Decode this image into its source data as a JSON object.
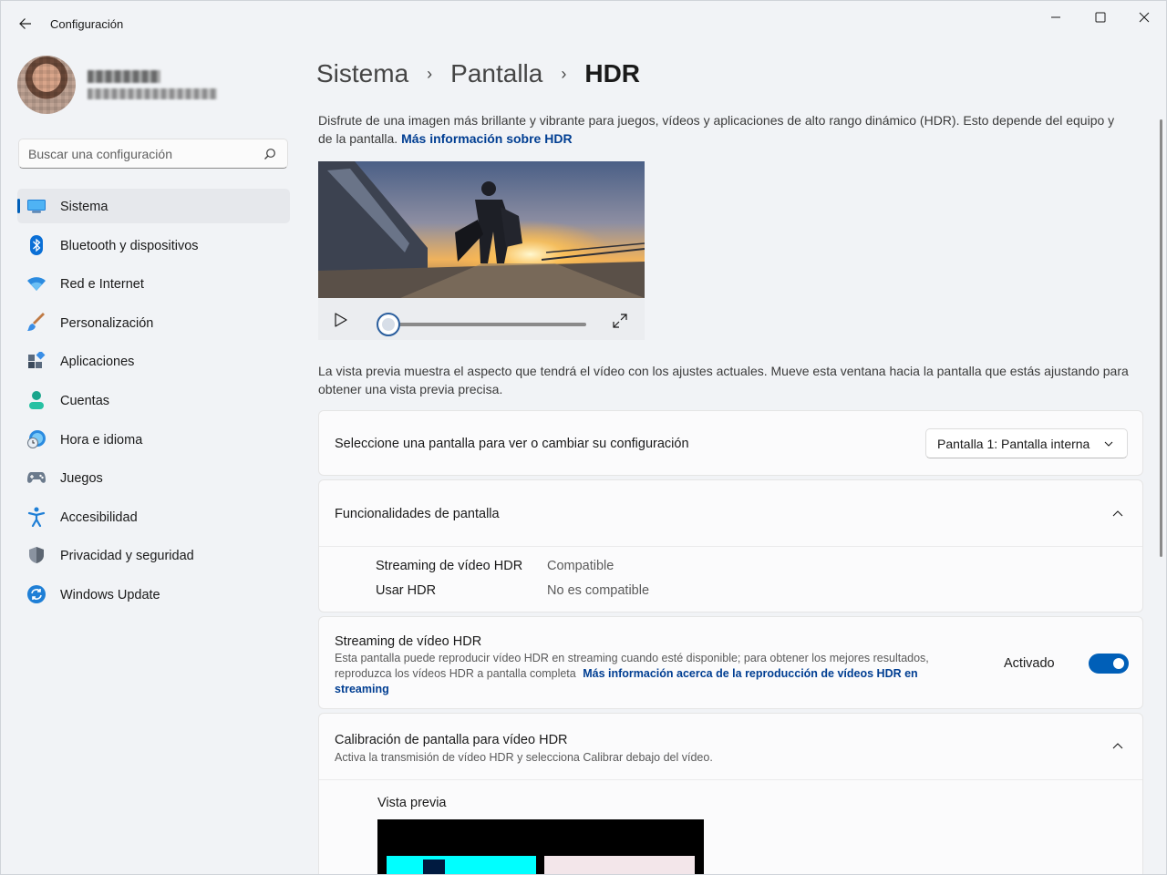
{
  "window": {
    "title": "Configuración"
  },
  "profile": {},
  "search": {
    "placeholder": "Buscar una configuración"
  },
  "sidebar": {
    "items": [
      {
        "label": "Sistema",
        "icon": "monitor-icon",
        "active": true
      },
      {
        "label": "Bluetooth y dispositivos",
        "icon": "bluetooth-icon"
      },
      {
        "label": "Red e Internet",
        "icon": "wifi-icon"
      },
      {
        "label": "Personalización",
        "icon": "brush-icon"
      },
      {
        "label": "Aplicaciones",
        "icon": "apps-icon"
      },
      {
        "label": "Cuentas",
        "icon": "person-icon"
      },
      {
        "label": "Hora e idioma",
        "icon": "globe-clock-icon"
      },
      {
        "label": "Juegos",
        "icon": "gamepad-icon"
      },
      {
        "label": "Accesibilidad",
        "icon": "accessibility-icon"
      },
      {
        "label": "Privacidad y seguridad",
        "icon": "shield-icon"
      },
      {
        "label": "Windows Update",
        "icon": "update-icon"
      }
    ]
  },
  "breadcrumb": {
    "level1": "Sistema",
    "level2": "Pantalla",
    "current": "HDR"
  },
  "intro": {
    "text": "Disfrute de una imagen más brillante y vibrante para juegos, vídeos y aplicaciones de alto rango dinámico (HDR). Esto depende del equipo y de la pantalla.",
    "link": "Más información sobre HDR"
  },
  "player": {
    "progress": 0
  },
  "preview_note": "La vista previa muestra el aspecto que tendrá el vídeo con los ajustes actuales. Mueve esta ventana hacia la pantalla que estás ajustando para obtener una vista previa precisa.",
  "display_select": {
    "label": "Seleccione una pantalla para ver o cambiar su configuración",
    "value": "Pantalla 1: Pantalla interna"
  },
  "features": {
    "title": "Funcionalidades de pantalla",
    "expanded": true,
    "rows": [
      {
        "name": "Streaming de vídeo HDR",
        "value": "Compatible"
      },
      {
        "name": "Usar HDR",
        "value": "No es compatible"
      }
    ]
  },
  "streaming": {
    "title": "Streaming de vídeo HDR",
    "desc": "Esta pantalla puede reproducir vídeo HDR en streaming cuando esté disponible; para obtener los mejores resultados, reproduzca los vídeos HDR a pantalla completa",
    "link": "Más información acerca de la reproducción de vídeos HDR en streaming",
    "toggle_label": "Activado",
    "toggle_on": true
  },
  "calibration": {
    "title": "Calibración de pantalla para vídeo HDR",
    "desc": "Activa la transmisión de vídeo HDR y selecciona Calibrar debajo del vídeo.",
    "expanded": true,
    "preview_title": "Vista previa"
  },
  "colors": {
    "accent": "#005fb8",
    "link": "#003e92"
  }
}
